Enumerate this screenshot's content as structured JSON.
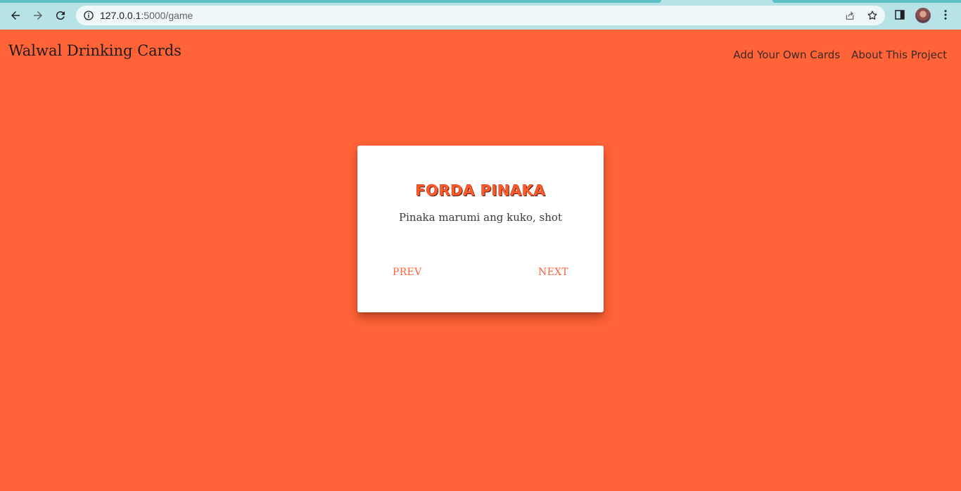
{
  "browser": {
    "url_host": "127.0.0.1",
    "url_path": ":5000/game",
    "icons": [
      "back-icon",
      "forward-icon",
      "reload-icon",
      "info-icon",
      "share-icon",
      "bookmark-star-icon",
      "side-panel-icon",
      "avatar",
      "menu-kebab-icon"
    ]
  },
  "header": {
    "title": "Walwal Drinking Cards",
    "nav": [
      {
        "label": "Add Your Own Cards"
      },
      {
        "label": "About This Project"
      }
    ]
  },
  "card": {
    "title": "FORDA PINAKA",
    "text": "Pinaka marumi ang kuko, shot",
    "prev_label": "PREV",
    "next_label": "NEXT"
  },
  "colors": {
    "background": "#ff6337",
    "card": "#ffffff",
    "accent": "#ff6337",
    "chrome": "#b7e3e6"
  }
}
